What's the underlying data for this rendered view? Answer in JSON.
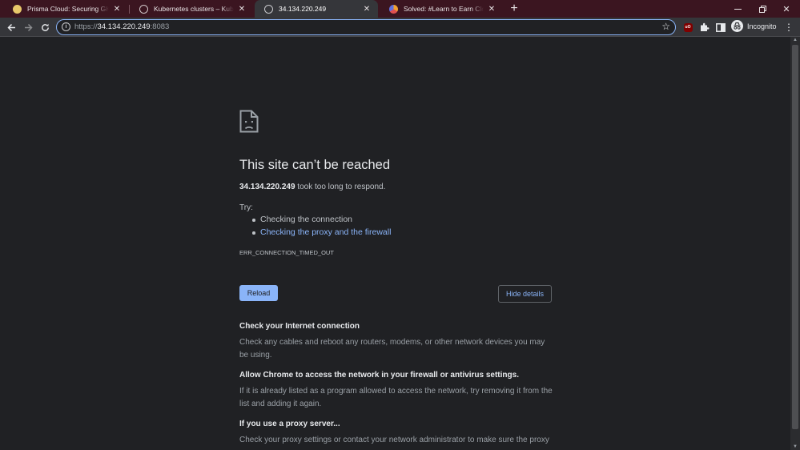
{
  "tabs": [
    {
      "title": "Prisma Cloud: Securing GKE Run",
      "favicon": "prisma-cloud-favicon",
      "active": false
    },
    {
      "title": "Kubernetes clusters – Kubernetes",
      "favicon": "globe-favicon",
      "active": false
    },
    {
      "title": "34.134.220.249",
      "favicon": "globe-favicon",
      "active": true
    },
    {
      "title": "Solved: #Learn to Earn Cloud Se",
      "favicon": "community-favicon",
      "active": false
    }
  ],
  "address_bar": {
    "scheme": "https://",
    "host": "34.134.220.249",
    "port": ":8083"
  },
  "profile": {
    "label": "Incognito"
  },
  "error": {
    "title": "This site can’t be reached",
    "host": "34.134.220.249",
    "message": "took too long to respond.",
    "try_label": "Try:",
    "suggestions": [
      "Checking the connection",
      "Checking the proxy and the firewall"
    ],
    "code": "ERR_CONNECTION_TIMED_OUT",
    "reload_label": "Reload",
    "details_label": "Hide details"
  },
  "details": [
    {
      "heading": "Check your Internet connection",
      "body": "Check any cables and reboot any routers, modems, or other network devices you may be using."
    },
    {
      "heading": "Allow Chrome to access the network in your firewall or antivirus settings.",
      "body": "If it is already listed as a program allowed to access the network, try removing it from the list and adding it again."
    },
    {
      "heading": "If you use a proxy server...",
      "body": "Check your proxy settings or contact your network administrator to make sure the proxy"
    }
  ],
  "colors": {
    "tabstrip": "#3b1520",
    "toolbar": "#35363a",
    "page_bg": "#202124",
    "accent_link": "#8ab4f8"
  }
}
